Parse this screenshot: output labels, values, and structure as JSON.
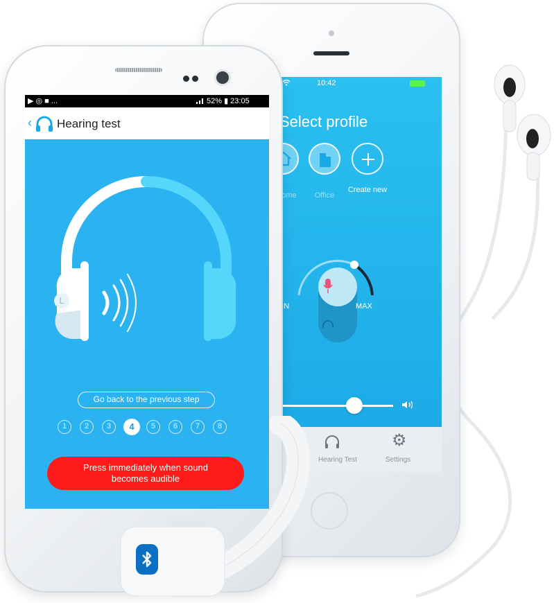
{
  "iphone": {
    "status_time": "10:42",
    "title": "Select profile",
    "profiles": [
      {
        "label": "Home",
        "icon": "house-icon"
      },
      {
        "label": "Office",
        "icon": "office-icon"
      },
      {
        "label": "Create new",
        "icon": "plus-icon"
      }
    ],
    "volume": {
      "min_label": "MIN",
      "max_label": "MAX"
    },
    "tabs": [
      {
        "label": "Hearing Test",
        "icon": "headphones-icon"
      },
      {
        "label": "Settings",
        "icon": "gear-icon"
      }
    ]
  },
  "android": {
    "status_left": "▶ ◎ ■ ...",
    "status_right": "52% ▮ 23:05",
    "header_title": "Hearing test",
    "back_step_label": "Go back to the previous step",
    "steps": [
      "1",
      "2",
      "3",
      "4",
      "5",
      "6",
      "7",
      "8"
    ],
    "active_step": "4",
    "press_button_label": "Press immediately when sound becomes audible",
    "ear_label": "L",
    "progress": 0.25
  },
  "bracelet": {
    "icon": "bluetooth-icon"
  },
  "colors": {
    "screen_blue": "#2ab3f0",
    "press_red": "#ff1a1a",
    "mic_pink": "#e9567b"
  }
}
